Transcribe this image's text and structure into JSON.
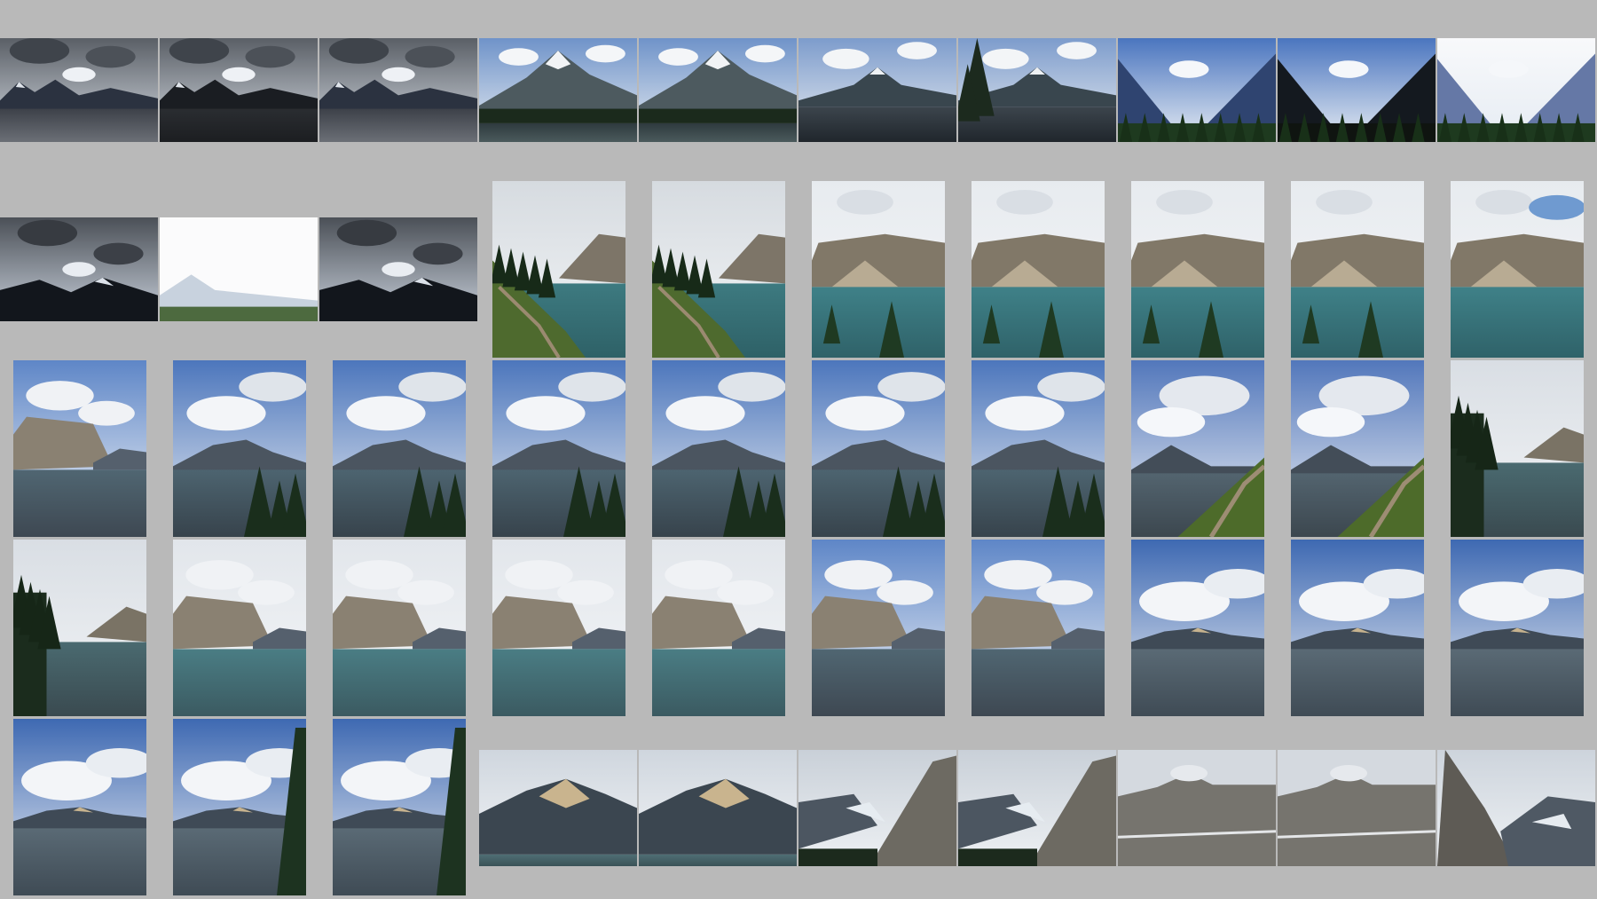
{
  "gallery": {
    "label": "Photo grid",
    "palette": {
      "background": "#b9b9b9",
      "lake_teal": "#3f7f86",
      "lake_grey": "#5a6570",
      "sky_blue": "#4a78c0",
      "storm_cloud": "#5c6068",
      "forest": "#1f3320",
      "rock": "#8a8477",
      "scree": "#b9ad98"
    },
    "rows": [
      {
        "name": "row-1",
        "count": 10,
        "orientation": "landscape",
        "scenes": [
          "storm-lake",
          "storm-lake-dark",
          "storm-lake",
          "peak-forest",
          "peak-forest",
          "peak-lake",
          "tree-peak-lake",
          "valley-blue",
          "valley-dark",
          "bright-valley"
        ]
      },
      {
        "name": "row-2",
        "count": 3,
        "orientation": "landscape",
        "scenes": [
          "storm-peaks",
          "overexposed",
          "storm-peaks"
        ]
      },
      {
        "name": "row-2b",
        "count": 7,
        "orientation": "portrait",
        "scenes": [
          "trail-lake",
          "trail-lake",
          "cliff-lake-tree",
          "cliff-lake-tree",
          "cliff-lake-tree",
          "cliff-lake-tree",
          "cliff-lake"
        ]
      },
      {
        "name": "row-3",
        "count": 10,
        "orientation": "portrait",
        "scenes": [
          "cliff-lake-blue",
          "trees-lake-blue",
          "trees-lake-blue",
          "trees-lake-blue",
          "trees-lake-blue",
          "trees-lake-blue",
          "trees-lake-blue",
          "hill-path",
          "hill-path",
          "forest-shore"
        ]
      },
      {
        "name": "row-4",
        "count": 10,
        "orientation": "portrait",
        "scenes": [
          "forest-shore",
          "grey-cliff-lake",
          "grey-cliff-lake",
          "grey-cliff-lake",
          "grey-cliff-lake",
          "cliff-lake-blue",
          "cliff-lake-blue",
          "blue-range-lake",
          "blue-range-lake",
          "blue-range-lake"
        ]
      },
      {
        "name": "row-5",
        "count": 3,
        "orientation": "portrait",
        "scenes": [
          "blue-range-lake",
          "tree-range-lake",
          "tree-range-lake"
        ]
      },
      {
        "name": "row-5b",
        "count": 7,
        "orientation": "landscape",
        "scenes": [
          "sunlit-ridge",
          "sunlit-ridge",
          "glacier-valley",
          "glacier-valley",
          "misty-cliffs",
          "misty-cliffs",
          "cliff-glacier"
        ]
      }
    ]
  }
}
